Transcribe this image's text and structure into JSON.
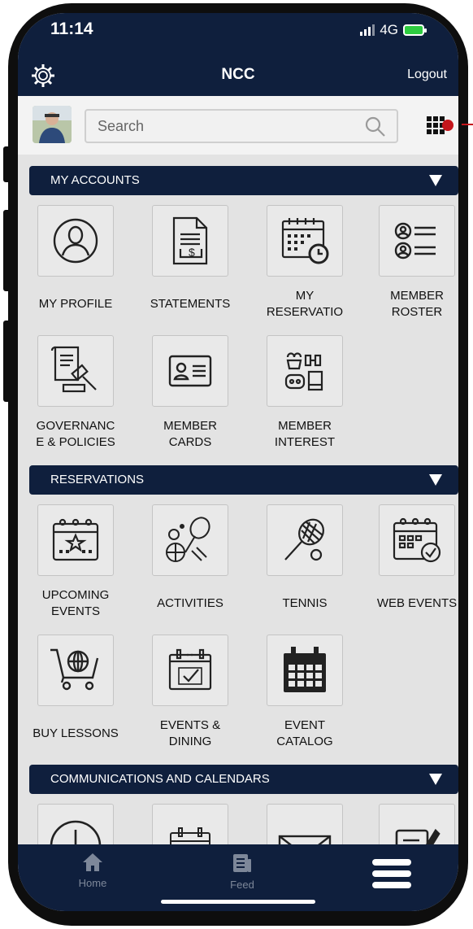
{
  "status_bar": {
    "time": "11:14",
    "network": "4G"
  },
  "header": {
    "title": "NCC",
    "logout_label": "Logout",
    "settings_icon": "gear-icon"
  },
  "search": {
    "placeholder": "Search"
  },
  "sections": [
    {
      "title": "MY ACCOUNTS",
      "tiles": [
        {
          "label": "MY PROFILE",
          "icon": "profile-icon"
        },
        {
          "label": "STATEMENTS",
          "icon": "statement-icon"
        },
        {
          "label_lines": [
            "MY",
            "RESERVATIO"
          ],
          "icon": "calendar-clock-icon"
        },
        {
          "label_lines": [
            "MEMBER",
            "ROSTER"
          ],
          "icon": "roster-icon"
        },
        {
          "label_lines": [
            "GOVERNANC",
            "E & POLICIES"
          ],
          "icon": "gavel-icon"
        },
        {
          "label_lines": [
            "MEMBER",
            "CARDS"
          ],
          "icon": "id-card-icon"
        },
        {
          "label_lines": [
            "MEMBER",
            "INTEREST"
          ],
          "icon": "interests-icon"
        }
      ]
    },
    {
      "title": "RESERVATIONS",
      "tiles": [
        {
          "label_lines": [
            "UPCOMING",
            "EVENTS"
          ],
          "icon": "calendar-star-icon"
        },
        {
          "label": "ACTIVITIES",
          "icon": "sports-icon"
        },
        {
          "label": "TENNIS",
          "icon": "tennis-icon"
        },
        {
          "label": "WEB EVENTS",
          "icon": "calendar-check-icon"
        },
        {
          "label": "BUY LESSONS",
          "icon": "cart-globe-icon"
        },
        {
          "label_lines": [
            "EVENTS &",
            "DINING"
          ],
          "icon": "calendar-tick-icon"
        },
        {
          "label_lines": [
            "EVENT",
            "CATALOG"
          ],
          "icon": "calendar-grid-icon"
        }
      ]
    },
    {
      "title": "COMMUNICATIONS AND CALENDARS"
    }
  ],
  "bottom_nav": {
    "home_label": "Home",
    "feed_label": "Feed"
  },
  "colors": {
    "navy": "#0f1f3d",
    "accent_red": "#c4161c",
    "background": "#e3e3e3"
  }
}
